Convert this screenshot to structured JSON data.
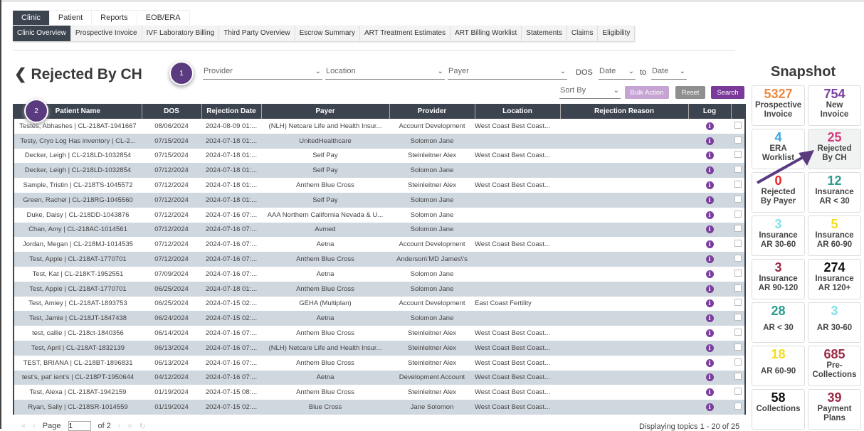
{
  "nav": {
    "tabs": [
      "Clinic",
      "Patient",
      "Reports",
      "EOB/ERA"
    ],
    "subtabs": [
      "Clinic Overview",
      "Prospective Invoice",
      "IVF Laboratory Billing",
      "Third Party Overview",
      "Escrow Summary",
      "ART Treatment Estimates",
      "ART Billing Worklist",
      "Statements",
      "Claims",
      "Eligibility"
    ]
  },
  "page": {
    "title": "Rejected By CH",
    "badge1": "1",
    "badge2": "2"
  },
  "filters": {
    "provider": "Provider",
    "location": "Location",
    "payer": "Payer",
    "dos_label": "DOS",
    "date_from": "Date",
    "to_label": "to",
    "date_to": "Date",
    "sort_by": "Sort By",
    "bulk_action": "Bulk Action",
    "reset": "Reset",
    "search": "Search"
  },
  "table": {
    "headers": [
      "Patient Name",
      "DOS",
      "Rejection Date",
      "Payer",
      "Provider",
      "Location",
      "Rejection Reason",
      "Log",
      ""
    ],
    "rows": [
      [
        "Testes, Abhashes | CL-218AT-1941667",
        "08/06/2024",
        "2024-08-09 01:...",
        "(NLH) Netcare Life and Health Insur...",
        "Account Development",
        "West Coast Best Coast...",
        ""
      ],
      [
        "Testy, Cryo Log Has inventory | CL-2...",
        "07/15/2024",
        "2024-07-18 01:...",
        "UnitedHealthcare",
        "Solomon Jane",
        "",
        ""
      ],
      [
        "Decker, Leigh | CL-218LD-1032854",
        "07/15/2024",
        "2024-07-18 01:...",
        "Self Pay",
        "Steinleitner Alex",
        "West Coast Best Coast...",
        ""
      ],
      [
        "Decker, Leigh | CL-218LD-1032854",
        "07/12/2024",
        "2024-07-18 01:...",
        "Self Pay",
        "Solomon Jane",
        "",
        ""
      ],
      [
        "Sample, Tristin | CL-218TS-1045572",
        "07/12/2024",
        "2024-07-18 01:...",
        "Anthem Blue Cross",
        "Steinleitner Alex",
        "West Coast Best Coast...",
        ""
      ],
      [
        "Green, Rachel | CL-218RG-1045560",
        "07/12/2024",
        "2024-07-18 01:...",
        "Self Pay",
        "Solomon Jane",
        "",
        ""
      ],
      [
        "Duke, Daisy | CL-218DD-1043876",
        "07/12/2024",
        "2024-07-16 07:...",
        "AAA Northern California Nevada & U...",
        "Solomon Jane",
        "",
        ""
      ],
      [
        "Chan, Amy | CL-218AC-1014561",
        "07/12/2024",
        "2024-07-16 07:...",
        "Avmed",
        "Solomon Jane",
        "",
        ""
      ],
      [
        "Jordan, Megan | CL-218MJ-1014535",
        "07/12/2024",
        "2024-07-16 07:...",
        "Aetna",
        "Account Development",
        "West Coast Best Coast...",
        ""
      ],
      [
        "Test, Apple | CL-218AT-1770701",
        "07/12/2024",
        "2024-07-16 07:...",
        "Anthem Blue Cross",
        "Anderson\\'MD James\\'s",
        "",
        ""
      ],
      [
        "Test, Kat | CL-218KT-1952551",
        "07/09/2024",
        "2024-07-16 07:...",
        "Aetna",
        "Solomon Jane",
        "",
        ""
      ],
      [
        "Test, Apple | CL-218AT-1770701",
        "06/25/2024",
        "2024-07-18 01:...",
        "Anthem Blue Cross",
        "Solomon Jane",
        "",
        ""
      ],
      [
        "Test, Amiey | CL-218AT-1893753",
        "06/25/2024",
        "2024-07-15 02:...",
        "GEHA (Multiplan)",
        "Account Development",
        "East Coast Fertility",
        ""
      ],
      [
        "Test, Jamie | CL-218JT-1847438",
        "06/24/2024",
        "2024-07-15 02:...",
        "Aetna",
        "Solomon Jane",
        "",
        ""
      ],
      [
        "test, callie | CL-218ct-1840356",
        "06/14/2024",
        "2024-07-16 07:...",
        "Anthem Blue Cross",
        "Steinleitner Alex",
        "West Coast Best Coast...",
        ""
      ],
      [
        "Test, April | CL-218AT-1832139",
        "06/13/2024",
        "2024-07-16 07:...",
        "(NLH) Netcare Life and Health Insur...",
        "Steinleitner Alex",
        "West Coast Best Coast...",
        ""
      ],
      [
        "TEST, BRIANA | CL-218BT-1896831",
        "06/13/2024",
        "2024-07-16 07:...",
        "Anthem Blue Cross",
        "Steinleitner Alex",
        "West Coast Best Coast...",
        ""
      ],
      [
        "test's, pat' ient's | CL-218PT-1950644",
        "04/12/2024",
        "2024-07-16 07:...",
        "Aetna",
        "Development Account",
        "West Coast Best Coast...",
        ""
      ],
      [
        "Test, Alexa | CL-218AT-1942159",
        "01/19/2024",
        "2024-07-15 08:...",
        "Anthem Blue Cross",
        "Steinleitner Alex",
        "West Coast Best Coast...",
        ""
      ],
      [
        "Ryan, Sally | CL-218SR-1014559",
        "01/19/2024",
        "2024-07-15 02:...",
        "Blue Cross",
        "Jane Solomon",
        "West Coast Best Coast...",
        ""
      ]
    ]
  },
  "pager": {
    "page_label": "Page",
    "page": "1",
    "of_label": "of 2",
    "display": "Displaying topics 1 - 20 of 25"
  },
  "snapshot": {
    "title": "Snapshot",
    "cards": [
      {
        "value": "5327",
        "label": "Prospective Invoice",
        "color": "#f0883e"
      },
      {
        "value": "754",
        "label": "New Invoice",
        "color": "#7b3f9e"
      },
      {
        "value": "4",
        "label": "ERA Worklist",
        "color": "#3aa3e3"
      },
      {
        "value": "25",
        "label": "Rejected By CH",
        "color": "#d63a7a"
      },
      {
        "value": "0",
        "label": "Rejected By Payer",
        "color": "#f02020"
      },
      {
        "value": "12",
        "label": "Insurance AR < 30",
        "color": "#2a9d8f"
      },
      {
        "value": "3",
        "label": "Insurance AR 30-60",
        "color": "#7fe3ea"
      },
      {
        "value": "5",
        "label": "Insurance AR 60-90",
        "color": "#f5dc1a"
      },
      {
        "value": "3",
        "label": "Insurance AR 90-120",
        "color": "#9b2a45"
      },
      {
        "value": "274",
        "label": "Insurance AR 120+",
        "color": "#111111"
      },
      {
        "value": "28",
        "label": "AR < 30",
        "color": "#2a9d8f"
      },
      {
        "value": "3",
        "label": "AR 30-60",
        "color": "#7fe3ea"
      },
      {
        "value": "18",
        "label": "AR 60-90",
        "color": "#f5dc1a"
      },
      {
        "value": "685",
        "label": "Pre-Collections",
        "color": "#9b2a45"
      },
      {
        "value": "58",
        "label": "Collections",
        "color": "#111111"
      },
      {
        "value": "39",
        "label": "Payment Plans",
        "color": "#9b2a45"
      }
    ]
  }
}
